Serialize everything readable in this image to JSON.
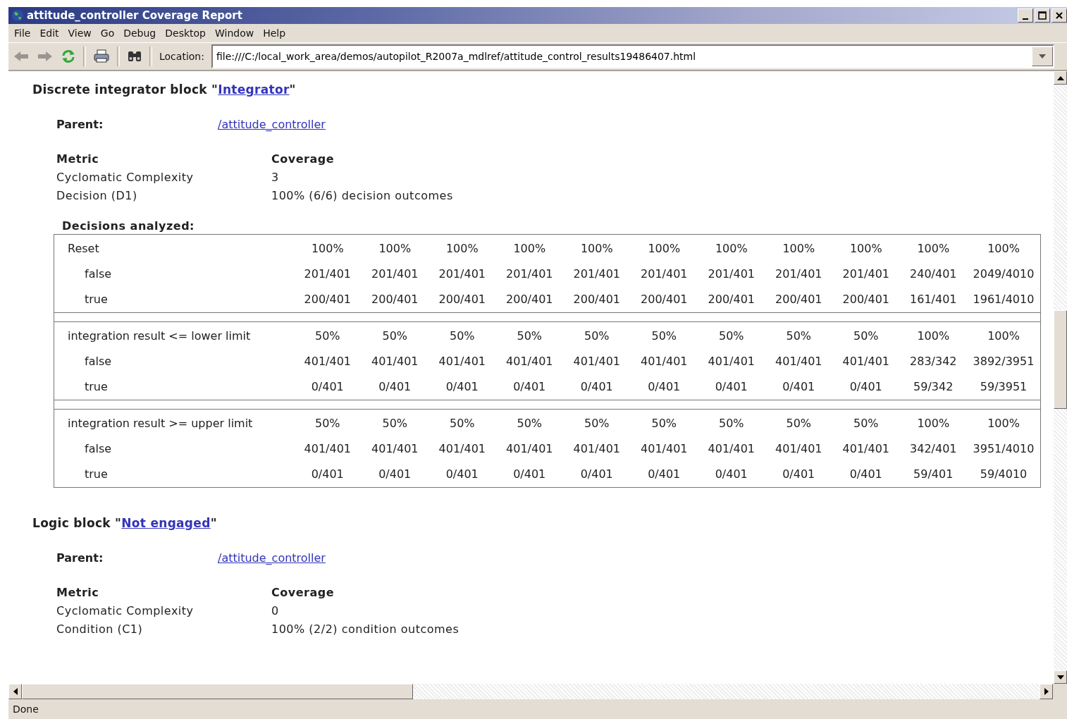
{
  "window": {
    "title": "attitude_controller Coverage Report"
  },
  "menu": [
    "File",
    "Edit",
    "View",
    "Go",
    "Debug",
    "Desktop",
    "Window",
    "Help"
  ],
  "toolbar": {
    "location_label": "Location:",
    "location": "file:///C:/local_work_area/demos/autopilot_R2007a_mdlref/attitude_control_results19486407.html"
  },
  "blocks": [
    {
      "heading": "Discrete integrator block \"",
      "link": "Integrator",
      "heading_end": "\"",
      "parent_label": "Parent:",
      "parent": "/attitude_controller",
      "metric_header": "Metric",
      "coverage_header": "Coverage",
      "metrics": [
        {
          "name": "Cyclomatic Complexity",
          "value": "3"
        },
        {
          "name": "Decision (D1)",
          "value": "100% (6/6) decision outcomes"
        }
      ],
      "decisions_title": "Decisions analyzed:",
      "decisions": [
        {
          "label": "Reset",
          "values": [
            "100%",
            "100%",
            "100%",
            "100%",
            "100%",
            "100%",
            "100%",
            "100%",
            "100%",
            "100%",
            "100%"
          ],
          "outcomes": [
            {
              "label": "false",
              "values": [
                "201/401",
                "201/401",
                "201/401",
                "201/401",
                "201/401",
                "201/401",
                "201/401",
                "201/401",
                "201/401",
                "240/401",
                "2049/4010"
              ]
            },
            {
              "label": "true",
              "values": [
                "200/401",
                "200/401",
                "200/401",
                "200/401",
                "200/401",
                "200/401",
                "200/401",
                "200/401",
                "200/401",
                "161/401",
                "1961/4010"
              ]
            }
          ]
        },
        {
          "label": "integration result <= lower limit",
          "values": [
            "50%",
            "50%",
            "50%",
            "50%",
            "50%",
            "50%",
            "50%",
            "50%",
            "50%",
            "100%",
            "100%"
          ],
          "outcomes": [
            {
              "label": "false",
              "values": [
                "401/401",
                "401/401",
                "401/401",
                "401/401",
                "401/401",
                "401/401",
                "401/401",
                "401/401",
                "401/401",
                "283/342",
                "3892/3951"
              ]
            },
            {
              "label": "true",
              "values": [
                "0/401",
                "0/401",
                "0/401",
                "0/401",
                "0/401",
                "0/401",
                "0/401",
                "0/401",
                "0/401",
                "59/342",
                "59/3951"
              ]
            }
          ]
        },
        {
          "label": "integration result >= upper limit",
          "values": [
            "50%",
            "50%",
            "50%",
            "50%",
            "50%",
            "50%",
            "50%",
            "50%",
            "50%",
            "100%",
            "100%"
          ],
          "outcomes": [
            {
              "label": "false",
              "values": [
                "401/401",
                "401/401",
                "401/401",
                "401/401",
                "401/401",
                "401/401",
                "401/401",
                "401/401",
                "401/401",
                "342/401",
                "3951/4010"
              ]
            },
            {
              "label": "true",
              "values": [
                "0/401",
                "0/401",
                "0/401",
                "0/401",
                "0/401",
                "0/401",
                "0/401",
                "0/401",
                "0/401",
                "59/401",
                "59/4010"
              ]
            }
          ]
        }
      ]
    },
    {
      "heading": "Logic block \"",
      "link": "Not engaged",
      "heading_end": "\"",
      "parent_label": "Parent:",
      "parent": "/attitude_controller",
      "metric_header": "Metric",
      "coverage_header": "Coverage",
      "metrics": [
        {
          "name": "Cyclomatic Complexity",
          "value": "0"
        },
        {
          "name": "Condition (C1)",
          "value": "100% (2/2) condition outcomes"
        }
      ]
    }
  ],
  "status_bar": "Done"
}
